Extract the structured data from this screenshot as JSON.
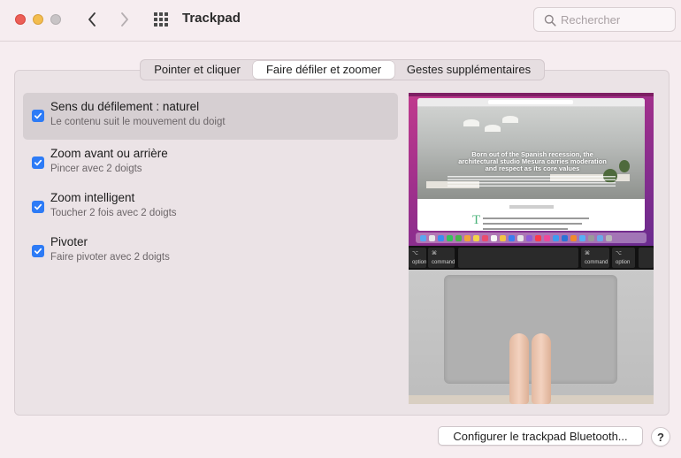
{
  "window": {
    "title": "Trackpad"
  },
  "search": {
    "placeholder": "Rechercher"
  },
  "tabs": [
    {
      "label": "Pointer et cliquer",
      "selected": false
    },
    {
      "label": "Faire défiler et zoomer",
      "selected": true
    },
    {
      "label": "Gestes supplémentaires",
      "selected": false
    }
  ],
  "options": [
    {
      "title": "Sens du défilement : naturel",
      "description": "Le contenu suit le mouvement du doigt",
      "checked": true,
      "selected": true
    },
    {
      "title": "Zoom avant ou arrière",
      "description": "Pincer avec 2 doigts",
      "checked": true,
      "selected": false
    },
    {
      "title": "Zoom intelligent",
      "description": "Toucher 2 fois avec 2 doigts",
      "checked": true,
      "selected": false
    },
    {
      "title": "Pivoter",
      "description": "Faire pivoter avec 2 doigts",
      "checked": true,
      "selected": false
    }
  ],
  "preview": {
    "hero_text": "Born out of the Spanish recession, the architectural studio Mesura carries moderation and respect as its core values",
    "keys": {
      "left_option_symbol": "⌥",
      "left_option_label": "option",
      "left_command_symbol": "⌘",
      "left_command_label": "command",
      "right_command_symbol": "⌘",
      "right_command_label": "command",
      "right_option_symbol": "⌥",
      "right_option_label": "option"
    }
  },
  "buttons": {
    "configure_bluetooth": "Configurer le trackpad Bluetooth...",
    "help": "?"
  },
  "colors": {
    "accent": "#2d7bf6",
    "close": "#ec5f57",
    "minimize": "#f3bd4f",
    "zoom_disabled": "#c8c4c6"
  },
  "icons": {
    "back": "chevron-left-icon",
    "forward": "chevron-right-icon",
    "show_all": "grid-icon",
    "search": "search-icon",
    "checkbox": "checkmark-icon"
  }
}
